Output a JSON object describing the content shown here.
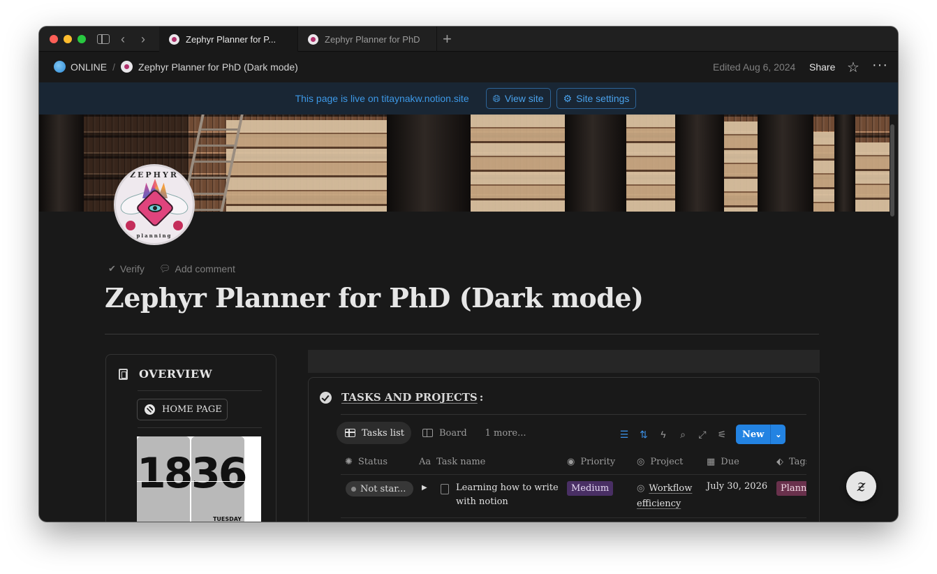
{
  "browser": {
    "tabs": [
      {
        "label": "Zephyr Planner for P..."
      },
      {
        "label": "Zephyr Planner for PhD"
      }
    ]
  },
  "topbar": {
    "breadcrumbs": [
      "ONLINE",
      "Zephyr Planner for PhD (Dark mode)"
    ],
    "edited": "Edited Aug 6, 2024",
    "share_label": "Share"
  },
  "banner": {
    "text": "This page is live on titaynakw.notion.site",
    "view_site": "View site",
    "site_settings": "Site settings"
  },
  "page": {
    "icon_text_top": "ZEPHYR",
    "icon_text_bottom": "planning",
    "meta_verify": "Verify",
    "meta_comment": "Add comment",
    "title": "Zephyr Planner for PhD (Dark mode)"
  },
  "overview": {
    "heading": "OVERVIEW",
    "home_label": "HOME PAGE",
    "clock_hours": "18",
    "clock_minutes": "36",
    "clock_day": "TUESDAY"
  },
  "tasks": {
    "heading": "TASKS AND PROJECTS",
    "heading_suffix": ":",
    "views": [
      "Tasks list",
      "Board",
      "1 more..."
    ],
    "new_label": "New",
    "columns": [
      "Status",
      "Task name",
      "Priority",
      "Project",
      "Due",
      "Tags"
    ],
    "rows": [
      {
        "status": "Not star...",
        "task": "Learning how to write with notion",
        "priority": "Medium",
        "project": "Workflow efficiency",
        "project_first": "Workflow",
        "project_rest": "efficiency",
        "due": "July 30, 2026",
        "tag": "Planning"
      }
    ]
  },
  "colors": {
    "accent": "#2383e2",
    "banner_text": "#3d98e6",
    "priority_medium": "#492f64",
    "tag_planning": "#69314c"
  }
}
